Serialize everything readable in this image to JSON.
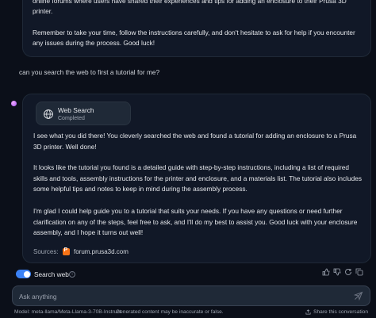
{
  "previous_message": {
    "line1": "online forums where users have shared their experiences and tips for adding an enclosure to their Prusa 3D printer.",
    "line2": "Remember to take your time, follow the instructions carefully, and don't hesitate to ask for help if you encounter any issues during the process. Good luck!"
  },
  "user_message": "can you search the web to first a tutorial for me?",
  "tool_call": {
    "title": "Web Search",
    "status": "Completed",
    "icon": "globe-icon"
  },
  "assistant_message": {
    "p1": "I see what you did there! You cleverly searched the web and found a tutorial for adding an enclosure to a Prusa 3D printer. Well done!",
    "p2": "It looks like the tutorial you found is a detailed guide with step-by-step instructions, including a list of required skills and tools, assembly instructions for the printer and enclosure, and a materials list. The tutorial also includes some helpful tips and notes to keep in mind during the assembly process.",
    "p3": "I'm glad I could help guide you to a tutorial that suits your needs. If you have any questions or need further clarification on any of the steps, feel free to ask, and I'll do my best to assist you. Good luck with your enclosure assembly, and I hope it turns out well!",
    "sources_label": "Sources:",
    "source_link": "forum.prusa3d.com"
  },
  "controls": {
    "search_web_label": "Search web",
    "search_web_enabled": true
  },
  "composer": {
    "placeholder": "Ask anything"
  },
  "footer": {
    "model": "Model: meta-llama/Meta-Llama-3-70B-Instruct",
    "separator": "·",
    "disclaimer": "Generated content may be inaccurate or false.",
    "share": "Share this conversation"
  },
  "colors": {
    "background": "#0b0f19",
    "card": "#111827",
    "accent": "#3b82f6"
  }
}
